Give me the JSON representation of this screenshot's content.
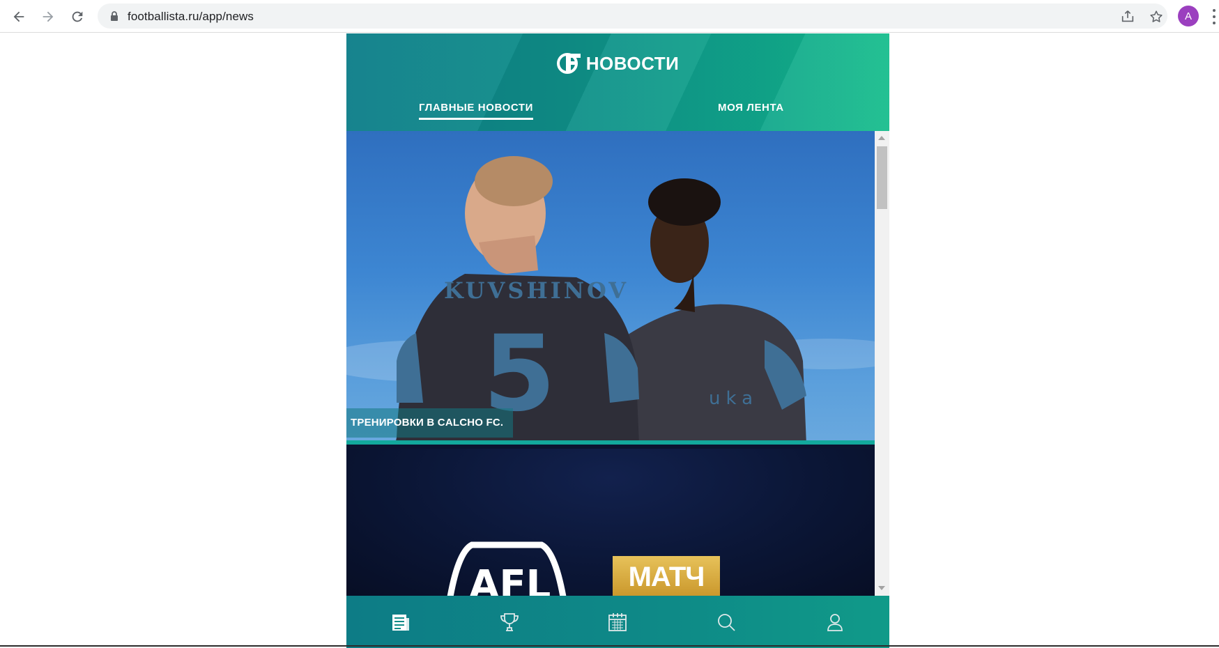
{
  "browser": {
    "url": "footballista.ru/app/news",
    "profile_initial": "A",
    "icons": [
      "back-arrow-icon",
      "forward-arrow-icon",
      "reload-icon",
      "lock-icon",
      "share-icon",
      "star-icon",
      "more-vert-icon"
    ],
    "colors": {
      "avatar": "#9b3fbf",
      "omnibox": "#f1f3f4"
    }
  },
  "app": {
    "title": "НОВОСТИ",
    "tabs": [
      {
        "label": "ГЛАВНЫЕ НОВОСТИ",
        "active": true
      },
      {
        "label": "МОЯ ЛЕНТА",
        "active": false
      }
    ],
    "feed": [
      {
        "caption": "ТРЕНИРОВКИ В CALCHO FC."
      },
      {
        "logos": [
          "AFL",
          "МАТЧ"
        ]
      }
    ],
    "bottom_nav": [
      {
        "icon": "news-icon",
        "active": true
      },
      {
        "icon": "trophy-icon",
        "active": false
      },
      {
        "icon": "calendar-icon",
        "active": false
      },
      {
        "icon": "search-icon",
        "active": false
      },
      {
        "icon": "profile-icon",
        "active": false
      }
    ],
    "colors": {
      "header_start": "#0e7e89",
      "header_end": "#16bd8c",
      "accent": "#13a99c",
      "nav": "#0e8a87"
    }
  }
}
